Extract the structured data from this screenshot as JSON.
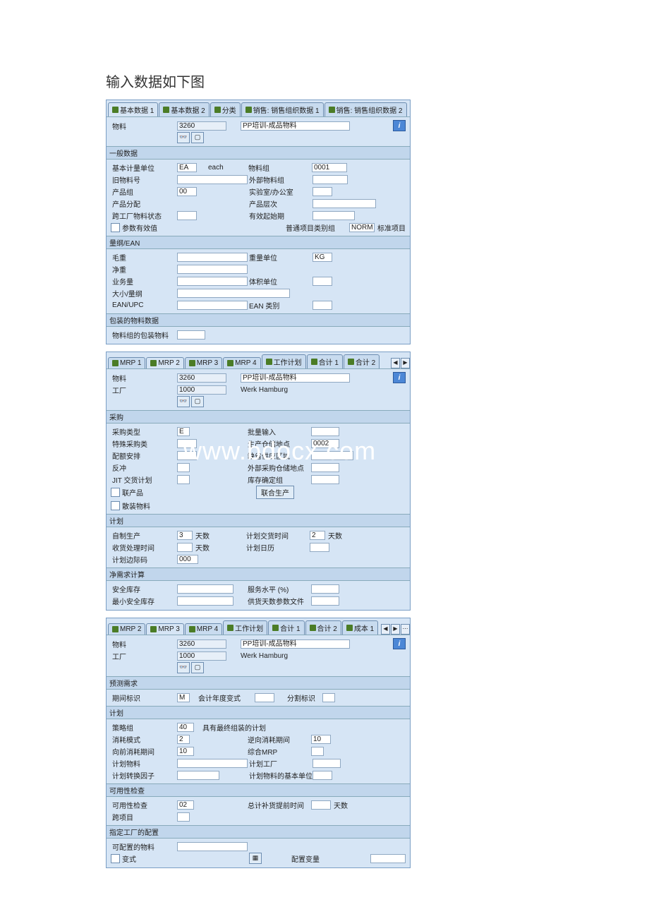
{
  "page_title": "输入数据如下图",
  "watermark": "www.bdocx.com",
  "shot1": {
    "tabs": [
      "基本数据 1",
      "基本数据 2",
      "分类",
      "销售: 销售组织数据 1",
      "销售: 销售组织数据 2"
    ],
    "material_lbl": "物料",
    "material_val": "3260",
    "desc_val": "PP培训-成品物料",
    "sec_general": "一般数据",
    "base_uom_lbl": "基本计量单位",
    "base_uom_val": "EA",
    "base_uom_txt": "each",
    "mat_grp_lbl": "物料组",
    "mat_grp_val": "0001",
    "old_mat_lbl": "旧物料号",
    "ext_mat_lbl": "外部物料组",
    "prod_grp_lbl": "产品组",
    "prod_grp_val": "00",
    "lab_lbl": "实验室/办公室",
    "prod_alloc_lbl": "产品分配",
    "prod_level_lbl": "产品层次",
    "xplant_lbl": "跨工厂物料状态",
    "valid_from_lbl": "有效起始期",
    "param_lbl": "参数有效值",
    "gen_item_lbl": "普通项目类别组",
    "gen_item_val": "NORM",
    "gen_item_txt": "标准项目",
    "sec_ean": "量纲/EAN",
    "gross_lbl": "毛重",
    "wt_unit_lbl": "重量单位",
    "wt_unit_val": "KG",
    "net_lbl": "净重",
    "biz_lbl": "业务量",
    "vol_unit_lbl": "体积单位",
    "size_lbl": "大小/量纲",
    "ean_lbl": "EAN/UPC",
    "ean_cat_lbl": "EAN 类别",
    "sec_pack": "包装的物料数据",
    "pack_mat_lbl": "物料组的包装物料"
  },
  "shot2": {
    "tabs": [
      "MRP 1",
      "MRP 2",
      "MRP 3",
      "MRP 4",
      "工作计划",
      "合计 1",
      "合计 2"
    ],
    "material_lbl": "物料",
    "material_val": "3260",
    "desc_val": "PP培训-成品物料",
    "plant_lbl": "工厂",
    "plant_val": "1000",
    "plant_txt": "Werk Hamburg",
    "sec_proc": "采购",
    "proc_type_lbl": "采购类型",
    "proc_type_val": "E",
    "batch_lbl": "批量输入",
    "spec_proc_lbl": "特殊采购类",
    "prod_loc_lbl": "生产仓储地点",
    "prod_loc_val": "0002",
    "quota_lbl": "配额安排",
    "vendor_area_lbl": "缺省供应区域",
    "backflush_lbl": "反冲",
    "ext_proc_lbl": "外部采购仓储地点",
    "jit_lbl": "JIT 交货计划",
    "stock_det_lbl": "库存确定组",
    "coprod_lbl": "联产品",
    "joint_btn": "联合生产",
    "bulk_lbl": "散装物料",
    "sec_sched": "计划",
    "inhouse_lbl": "自制生产",
    "inhouse_val": "3",
    "days": "天数",
    "sched_margin_lbl": "计划交货时间",
    "sched_margin_val": "2",
    "gr_time_lbl": "收货处理时间",
    "plan_cal_lbl": "计划日历",
    "sched_key_lbl": "计划边际码",
    "sched_key_val": "000",
    "sec_net": "净需求计算",
    "safety_lbl": "安全库存",
    "svc_lbl": "服务水平 (%)",
    "min_safety_lbl": "最小安全库存",
    "cov_prof_lbl": "供货天数参数文件"
  },
  "shot3": {
    "tabs": [
      "MRP 2",
      "MRP 3",
      "MRP 4",
      "工作计划",
      "合计 1",
      "合计 2",
      "成本 1"
    ],
    "material_lbl": "物料",
    "material_val": "3260",
    "desc_val": "PP培训-成品物料",
    "plant_lbl": "工厂",
    "plant_val": "1000",
    "plant_txt": "Werk Hamburg",
    "sec_fore": "预测需求",
    "period_lbl": "期间标识",
    "period_val": "M",
    "fy_lbl": "会计年度变式",
    "split_lbl": "分割标识",
    "sec_plan": "计划",
    "strat_lbl": "策略组",
    "strat_val": "40",
    "strat_txt": "具有最终组装的计划",
    "cons_mode_lbl": "消耗模式",
    "cons_mode_val": "2",
    "bwd_cons_lbl": "逆向消耗期间",
    "bwd_cons_val": "10",
    "fwd_lbl": "向前消耗期间",
    "fwd_val": "10",
    "mixed_lbl": "综合MRP",
    "plan_mat_lbl": "计划物料",
    "plan_plant_lbl": "计划工厂",
    "conv_lbl": "计划转换因子",
    "plan_uom_lbl": "计划物料的基本单位",
    "sec_avail": "可用性检查",
    "avail_lbl": "可用性检查",
    "avail_val": "02",
    "tot_repl_lbl": "总计补货提前时间",
    "cross_lbl": "跨项目",
    "sec_plant_conf": "指定工厂的配置",
    "conf_mat_lbl": "可配置的物料",
    "variant_lbl": "变式",
    "conf_var_lbl": "配置变量"
  }
}
